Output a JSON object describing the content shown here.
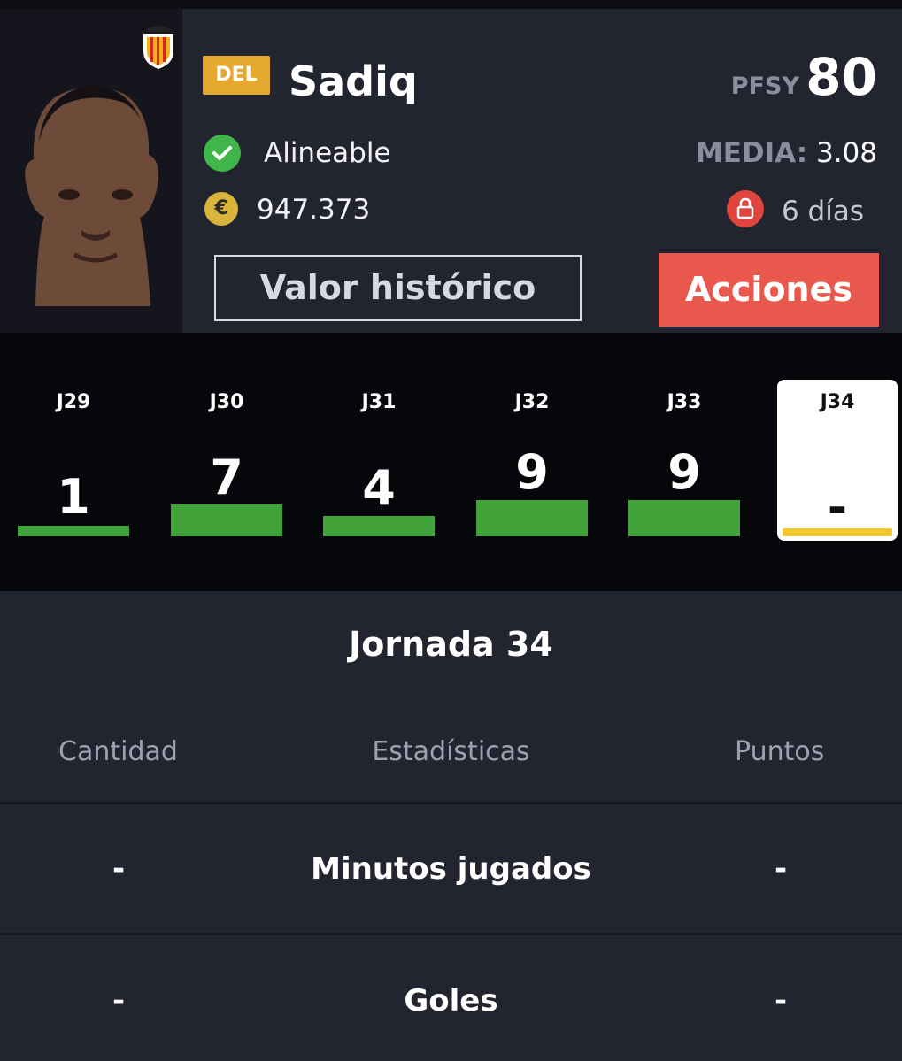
{
  "player": {
    "position": "DEL",
    "name": "Sadiq",
    "pfsy_label": "PFSY",
    "pfsy_value": "80",
    "status": "Alineable",
    "media_label": "MEDIA:",
    "media_value": "3.08",
    "value": "947.373",
    "lock_text": "6 días"
  },
  "actions": {
    "history_label": "Valor histórico",
    "actions_label": "Acciones"
  },
  "rounds": [
    {
      "label": "J29",
      "points": "1"
    },
    {
      "label": "J30",
      "points": "7"
    },
    {
      "label": "J31",
      "points": "4"
    },
    {
      "label": "J32",
      "points": "9"
    },
    {
      "label": "J33",
      "points": "9"
    },
    {
      "label": "J34",
      "points": "-"
    }
  ],
  "detail": {
    "title": "Jornada 34",
    "columns": [
      "Cantidad",
      "Estadísticas",
      "Puntos"
    ],
    "rows": [
      {
        "cantidad": "-",
        "stat": "Minutos jugados",
        "puntos": "-"
      },
      {
        "cantidad": "-",
        "stat": "Goles",
        "puntos": "-"
      }
    ]
  },
  "colors": {
    "background": "#22242f",
    "accent_red": "#e9584c",
    "badge_gold": "#e5a830",
    "bar_green": "#42a33a",
    "highlight_yellow": "#f2c831"
  },
  "icons": [
    "valencia-crest-icon",
    "check-circle-icon",
    "euro-coin-icon",
    "lock-icon"
  ]
}
